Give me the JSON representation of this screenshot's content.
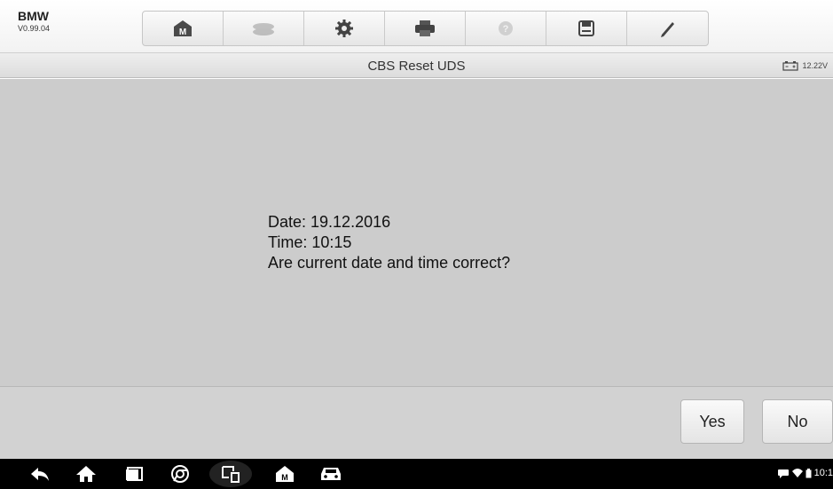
{
  "header": {
    "vehicle_make": "BMW",
    "software_version": "V0.99.04",
    "toolbar": [
      {
        "name": "home-icon",
        "label": "Home"
      },
      {
        "name": "vehicle-swap-icon",
        "label": "Vehicle Swap"
      },
      {
        "name": "settings-icon",
        "label": "Settings"
      },
      {
        "name": "print-icon",
        "label": "Print"
      },
      {
        "name": "help-icon",
        "label": "Help"
      },
      {
        "name": "save-icon",
        "label": "Save"
      },
      {
        "name": "edit-icon",
        "label": "Data Logging"
      }
    ]
  },
  "titlebar": {
    "title": "CBS Reset UDS",
    "battery_voltage": "12.22V"
  },
  "message": {
    "date_line": "Date: 19.12.2016",
    "time_line": "Time: 10:15",
    "question": "Are current date and time correct?"
  },
  "actions": {
    "yes_label": "Yes",
    "no_label": "No"
  },
  "navbar": {
    "icons": [
      "back-icon",
      "home-icon",
      "recent-apps-icon",
      "browser-icon",
      "screenshot-icon",
      "maxisys-home-icon",
      "vehicle-icon"
    ],
    "status_time": "10:1",
    "colors": {
      "bar": "#000000",
      "icon": "#ffffff"
    }
  }
}
